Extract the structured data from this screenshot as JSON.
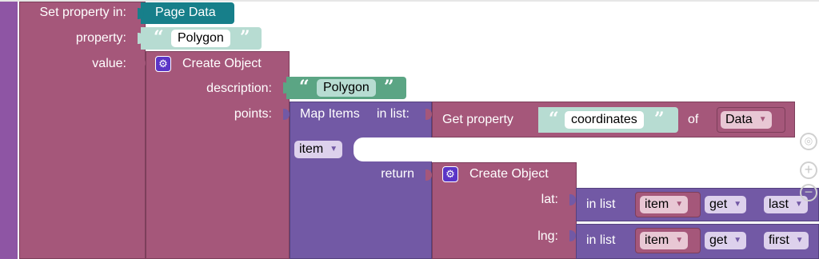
{
  "set_block": {
    "label_set": "Set property in:",
    "label_property": "property:",
    "label_value": "value:",
    "target": "Page Data",
    "property_value": "Polygon"
  },
  "create_object_outer": {
    "title": "Create Object",
    "label_description": "description:",
    "label_points": "points:",
    "description_value": "Polygon",
    "gear_icon": "gear-icon"
  },
  "map_items": {
    "title": "Map Items",
    "label_in_list": "in list:",
    "variable": "item",
    "label_return": "return"
  },
  "get_property": {
    "title": "Get property",
    "property": "coordinates",
    "label_of": "of",
    "source": "Data"
  },
  "create_object_inner": {
    "title": "Create Object",
    "label_lat": "lat:",
    "label_lng": "lng:"
  },
  "lat_getter": {
    "label_in_list": "in list",
    "item": "item",
    "op": "get",
    "where": "last"
  },
  "lng_getter": {
    "label_in_list": "in list",
    "item": "item",
    "op": "get",
    "where": "first"
  },
  "workspace_controls": {
    "icons": [
      "target-icon",
      "zoom-in-icon",
      "zoom-out-icon"
    ]
  },
  "colors": {
    "object_block": "#a5577a",
    "list_block": "#7259a5",
    "page_data": "#177f8a",
    "text_block": "#b7dcd2",
    "text_block_alt": "#5ba584",
    "gear": "#5b35c7",
    "left_bar": "#8e55a4"
  }
}
